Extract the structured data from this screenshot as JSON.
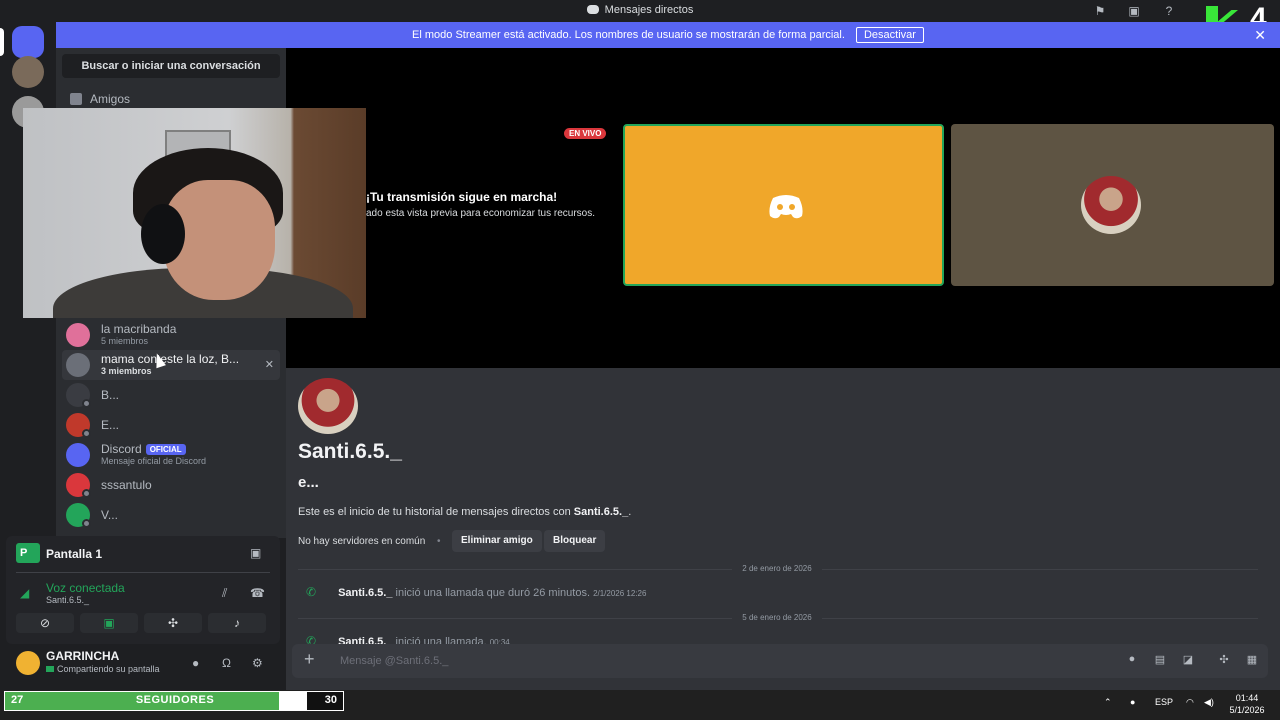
{
  "window": {
    "title": "Mensajes directos"
  },
  "banner": {
    "text": "El modo Streamer está activado. Los nombres de usuario se mostrarán de forma parcial.",
    "button": "Desactivar"
  },
  "sidebar": {
    "search_label": "Buscar o iniciar una conversación",
    "friends_label": "Amigos",
    "dms": [
      {
        "name": "la macribanda",
        "sub": "5 miembros",
        "avatar_color": "#e0709a"
      },
      {
        "name": "mama conteste la loz, B...",
        "sub": "3 miembros",
        "avatar_color": "#6b6f78"
      },
      {
        "name": "B...",
        "sub": "",
        "avatar_color": "#3a3c42"
      },
      {
        "name": "E...",
        "sub": "",
        "avatar_color": "#c0392b"
      },
      {
        "name": "Discord",
        "badge": "OFICIAL",
        "sub": "Mensaje oficial de Discord",
        "avatar_color": "#5865f2"
      },
      {
        "name": "sssantulo",
        "sub": "",
        "avatar_color": "#da373c"
      },
      {
        "name": "V...",
        "sub": "",
        "avatar_color": "#23a55a"
      }
    ]
  },
  "voice": {
    "share_title": "Pantalla 1",
    "status": "Voz conectada",
    "channel": "Santi.6.5._"
  },
  "user": {
    "name": "GARRINCHA",
    "status": "Compartiendo su pantalla"
  },
  "stream": {
    "live_badge": "EN VIVO",
    "title": "¡Tu transmisión sigue en marcha!",
    "subtitle": "ado esta vista previa para economizar tus recursos."
  },
  "chat": {
    "display_name": "Santi.6.5._",
    "username": "e...",
    "intro_prefix": "Este es el inicio de tu historial de mensajes directos con ",
    "intro_name": "Santi.6.5._",
    "intro_suffix": ".",
    "common_servers": "No hay servidores en común",
    "remove_friend": "Eliminar amigo",
    "block": "Bloquear",
    "date1": "2 de enero de 2026",
    "call1_user": "Santi.6.5._",
    "call1_text": " inició una llamada que duró 26 minutos.",
    "call1_time": "2/1/2026 12:26",
    "date2": "5 de enero de 2026",
    "call2_user": "Santi.6.5._",
    "call2_text": " inició una llamada.",
    "call2_time": "00:34",
    "input_placeholder": "Mensaje @Santi.6.5._"
  },
  "followers": {
    "current": "27",
    "label": "SEGUIDORES",
    "goal": "30",
    "progress": 0.9
  },
  "taskbar": {
    "lang": "ESP",
    "time": "01:44",
    "date": "5/1/2026"
  },
  "overlay_logo": {
    "number": "4"
  }
}
